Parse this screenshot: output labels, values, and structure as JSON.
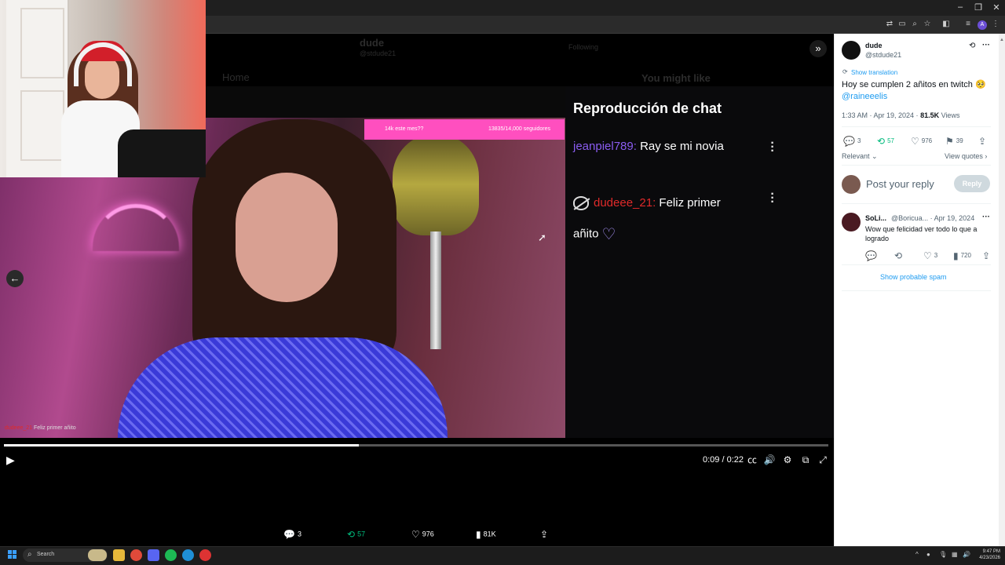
{
  "browser": {
    "window_controls": [
      "–",
      "❐",
      "✕"
    ],
    "profile_initial": "A"
  },
  "background_page": {
    "author_name": "dude",
    "handle": "@stdude21",
    "nav_home": "Home",
    "following": "Following",
    "sidebar_heading": "You might like"
  },
  "stream": {
    "sub_goal_left": "14k este mes??",
    "sub_goal_right": "13835/14,000 seguidores",
    "overlay_chat_user": "dudeee_21",
    "overlay_chat_text": "Feliz primer añito"
  },
  "chat_replay": {
    "title": "Reproducción de chat",
    "messages": [
      {
        "user": "jeanpiel789:",
        "text": " Ray se mi novia"
      },
      {
        "user": "dudeee_21:",
        "text": " Feliz primer",
        "text_line2": "añito"
      }
    ]
  },
  "video_controls": {
    "time": "0:09 / 0:22",
    "progress": 0.43
  },
  "bottom_stats": {
    "replies": "3",
    "reposts": "57",
    "likes": "976",
    "views": "81K"
  },
  "tweet": {
    "author_name": "dude",
    "author_handle": "@stdude21",
    "show_translation": "Show translation",
    "text": "Hoy se cumplen 2 añitos en twitch 🥺",
    "mention": "@raineeelis",
    "time": "1:33 AM · Apr 19, 2024 · ",
    "views_count": "81.5K",
    "views_label": " Views",
    "replies": "3",
    "reposts": "57",
    "likes": "976",
    "bookmarks": "39",
    "sort_label": "Relevant",
    "view_quotes": "View quotes",
    "reply_placeholder": "Post your reply",
    "reply_button": "Reply"
  },
  "reply": {
    "name": "SoLi...",
    "handle": "@Boricua... · Apr 19, 2024",
    "text": "Wow que felicidad ver todo lo que a logrado",
    "likes": "3",
    "views": "720"
  },
  "show_probable_spam": "Show probable spam",
  "taskbar": {
    "search_label": "Search",
    "time": "9:47 PM",
    "date": "4/23/2026"
  },
  "colors": {
    "accent_blue": "#1d9bf0",
    "repost_green": "#00ba7c",
    "sub_goal_pink": "#ff4fbf",
    "chat_user_purple": "#8a5cf0",
    "chat_user_red": "#e02a2a"
  }
}
